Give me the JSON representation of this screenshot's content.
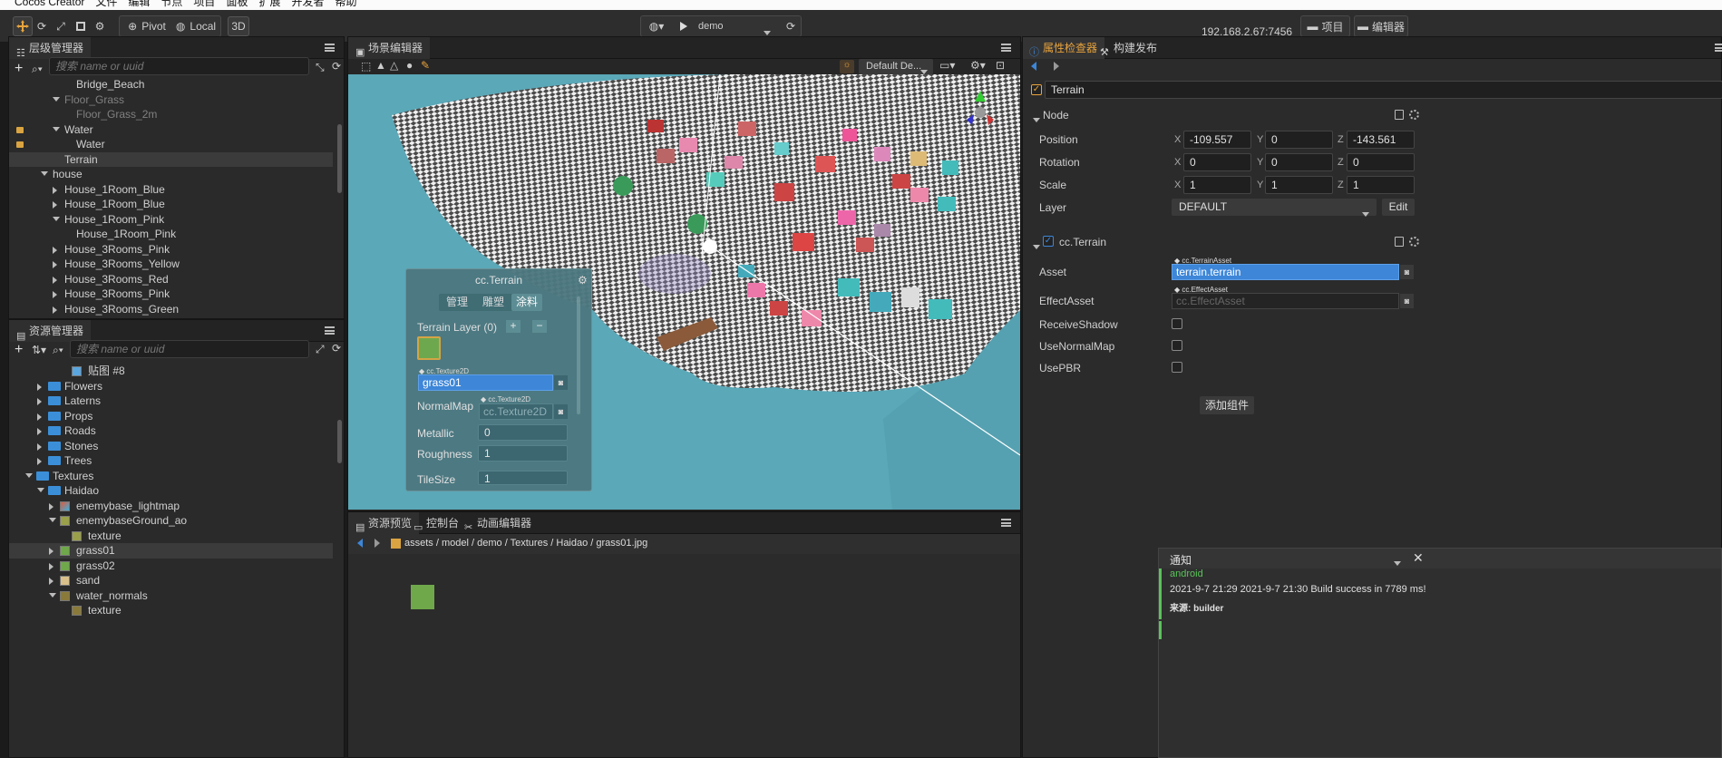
{
  "menubar": {
    "app_name": "Cocos Creator",
    "items": [
      "文件",
      "编辑",
      "节点",
      "项目",
      "面板",
      "扩展",
      "开发者",
      "帮助"
    ]
  },
  "toolbar": {
    "pivot_label": "Pivot",
    "local_label": "Local",
    "mode_3d_label": "3D",
    "scene_select": "demo",
    "ip_address": "192.168.2.67:7456",
    "project_label": "项目",
    "editor_label": "编辑器"
  },
  "hierarchy": {
    "title": "层级管理器",
    "search_placeholder": "搜索 name or uuid",
    "items": [
      {
        "label": "Bridge_Beach",
        "indent": 3,
        "arrow": "none",
        "dim": false,
        "lock": false,
        "selected": false
      },
      {
        "label": "Floor_Grass",
        "indent": 2,
        "arrow": "down",
        "dim": true,
        "lock": false,
        "selected": false
      },
      {
        "label": "Floor_Grass_2m",
        "indent": 3,
        "arrow": "none",
        "dim": true,
        "lock": false,
        "selected": false
      },
      {
        "label": "Water",
        "indent": 2,
        "arrow": "down",
        "dim": false,
        "lock": true,
        "selected": false
      },
      {
        "label": "Water",
        "indent": 3,
        "arrow": "none",
        "dim": false,
        "lock": true,
        "selected": false
      },
      {
        "label": "Terrain",
        "indent": 2,
        "arrow": "none",
        "dim": false,
        "lock": false,
        "selected": true
      },
      {
        "label": "house",
        "indent": 1,
        "arrow": "down",
        "dim": false,
        "lock": false,
        "selected": false
      },
      {
        "label": "House_1Room_Blue",
        "indent": 2,
        "arrow": "right",
        "dim": false,
        "lock": false,
        "selected": false
      },
      {
        "label": "House_1Room_Blue",
        "indent": 2,
        "arrow": "right",
        "dim": false,
        "lock": false,
        "selected": false
      },
      {
        "label": "House_1Room_Pink",
        "indent": 2,
        "arrow": "down",
        "dim": false,
        "lock": false,
        "selected": false
      },
      {
        "label": "House_1Room_Pink",
        "indent": 3,
        "arrow": "none",
        "dim": false,
        "lock": false,
        "selected": false
      },
      {
        "label": "House_3Rooms_Pink",
        "indent": 2,
        "arrow": "right",
        "dim": false,
        "lock": false,
        "selected": false
      },
      {
        "label": "House_3Rooms_Yellow",
        "indent": 2,
        "arrow": "right",
        "dim": false,
        "lock": false,
        "selected": false
      },
      {
        "label": "House_3Rooms_Red",
        "indent": 2,
        "arrow": "right",
        "dim": false,
        "lock": false,
        "selected": false
      },
      {
        "label": "House_3Rooms_Pink",
        "indent": 2,
        "arrow": "right",
        "dim": false,
        "lock": false,
        "selected": false
      },
      {
        "label": "House_3Rooms_Green",
        "indent": 2,
        "arrow": "right",
        "dim": false,
        "lock": false,
        "selected": false
      }
    ]
  },
  "assets": {
    "title": "资源管理器",
    "search_placeholder": "搜索 name or uuid",
    "items": [
      {
        "label": "贴图 #8",
        "indent": 4,
        "arrow": "none",
        "icon": "image",
        "selected": false
      },
      {
        "label": "Flowers",
        "indent": 2,
        "arrow": "right",
        "icon": "folder",
        "selected": false
      },
      {
        "label": "Laterns",
        "indent": 2,
        "arrow": "right",
        "icon": "folder",
        "selected": false
      },
      {
        "label": "Props",
        "indent": 2,
        "arrow": "right",
        "icon": "folder",
        "selected": false
      },
      {
        "label": "Roads",
        "indent": 2,
        "arrow": "right",
        "icon": "folder",
        "selected": false
      },
      {
        "label": "Stones",
        "indent": 2,
        "arrow": "right",
        "icon": "folder",
        "selected": false
      },
      {
        "label": "Trees",
        "indent": 2,
        "arrow": "right",
        "icon": "folder",
        "selected": false
      },
      {
        "label": "Textures",
        "indent": 1,
        "arrow": "down",
        "icon": "folder",
        "selected": false
      },
      {
        "label": "Haidao",
        "indent": 2,
        "arrow": "down",
        "icon": "folder",
        "selected": false
      },
      {
        "label": "enemybase_lightmap",
        "indent": 3,
        "arrow": "right",
        "icon": "lightmap",
        "selected": false
      },
      {
        "label": "enemybaseGround_ao",
        "indent": 3,
        "arrow": "down",
        "icon": "ao",
        "selected": false
      },
      {
        "label": "texture",
        "indent": 4,
        "arrow": "none",
        "icon": "ao",
        "selected": false
      },
      {
        "label": "grass01",
        "indent": 3,
        "arrow": "right",
        "icon": "grass",
        "selected": true
      },
      {
        "label": "grass02",
        "indent": 3,
        "arrow": "right",
        "icon": "grass",
        "selected": false
      },
      {
        "label": "sand",
        "indent": 3,
        "arrow": "right",
        "icon": "sand",
        "selected": false
      },
      {
        "label": "water_normals",
        "indent": 3,
        "arrow": "down",
        "icon": "normals",
        "selected": false
      },
      {
        "label": "texture",
        "indent": 4,
        "arrow": "none",
        "icon": "normals",
        "selected": false
      }
    ]
  },
  "scene": {
    "title": "场景编辑器",
    "camera_label": "Default De..."
  },
  "terrain_panel": {
    "title": "cc.Terrain",
    "tabs": [
      "管理",
      "雕塑",
      "涂料"
    ],
    "active_tab": 2,
    "layer_label": "Terrain Layer (0)",
    "texture_tag": "cc.Texture2D",
    "texture_value": "grass01",
    "normalmap_label": "NormalMap",
    "normalmap_tag": "cc.Texture2D",
    "normalmap_placeholder": "cc.Texture2D",
    "metallic_label": "Metallic",
    "metallic_value": "0",
    "roughness_label": "Roughness",
    "roughness_value": "1",
    "tilesize_label": "TileSize",
    "tilesize_value": "1"
  },
  "bottom": {
    "tabs": [
      "资源预览",
      "控制台",
      "动画编辑器"
    ],
    "path": [
      "assets",
      "model",
      "demo",
      "Textures",
      "Haidao",
      "grass01.jpg"
    ]
  },
  "inspector": {
    "tab_inspector": "属性检查器",
    "tab_build": "构建发布",
    "node_name": "Terrain",
    "node_section": "Node",
    "position": {
      "label": "Position",
      "x": "-109.557",
      "y": "0",
      "z": "-143.561"
    },
    "rotation": {
      "label": "Rotation",
      "x": "0",
      "y": "0",
      "z": "0"
    },
    "scale": {
      "label": "Scale",
      "x": "1",
      "y": "1",
      "z": "1"
    },
    "layer": {
      "label": "Layer",
      "value": "DEFAULT",
      "edit": "Edit"
    },
    "terrain_section": "cc.Terrain",
    "asset": {
      "label": "Asset",
      "tag": "cc.TerrainAsset",
      "value": "terrain.terrain"
    },
    "effect_asset": {
      "label": "EffectAsset",
      "tag": "cc.EffectAsset",
      "placeholder": "cc.EffectAsset"
    },
    "receive_shadow": "ReceiveShadow",
    "use_normal_map": "UseNormalMap",
    "use_pbr": "UsePBR",
    "add_component": "添加组件",
    "axis_x": "X",
    "axis_y": "Y",
    "axis_z": "Z"
  },
  "notification": {
    "title": "通知",
    "source_line": "android",
    "message": "2021-9-7 21:29 2021-9-7 21:30 Build success in 7789 ms!",
    "origin": "来源: builder"
  },
  "colors": {
    "accent": "#3d86d8",
    "selection": "#3b3b3b",
    "water": "#5aa8b8"
  }
}
